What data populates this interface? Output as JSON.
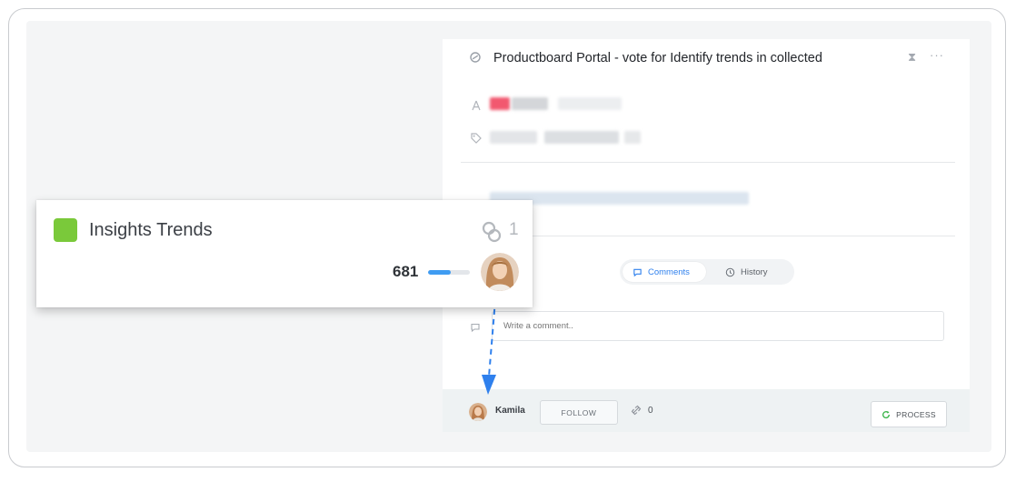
{
  "panel": {
    "title": "Productboard Portal - vote for Identify trends in collected",
    "comments_tab": "Comments",
    "history_tab": "History",
    "comment_placeholder": "Write a comment..",
    "footer": {
      "user_name": "Kamila",
      "follow_label": "FOLLOW",
      "link_count": "0",
      "process_label": "PROCESS"
    }
  },
  "card": {
    "title": "Insights Trends",
    "link_count": "1",
    "value": "681",
    "progress": 0.55,
    "color": "#7ac93a"
  },
  "colors": {
    "accent": "#2f80ed",
    "process_icon": "#3bb54a",
    "connector": "#2f80ed"
  },
  "icons": [
    "portal-icon",
    "collapse-icon",
    "more-icon",
    "user-icon",
    "tag-icon",
    "comment-bubble-icon",
    "clock-icon",
    "link-icon",
    "refresh-icon",
    "avatar"
  ]
}
